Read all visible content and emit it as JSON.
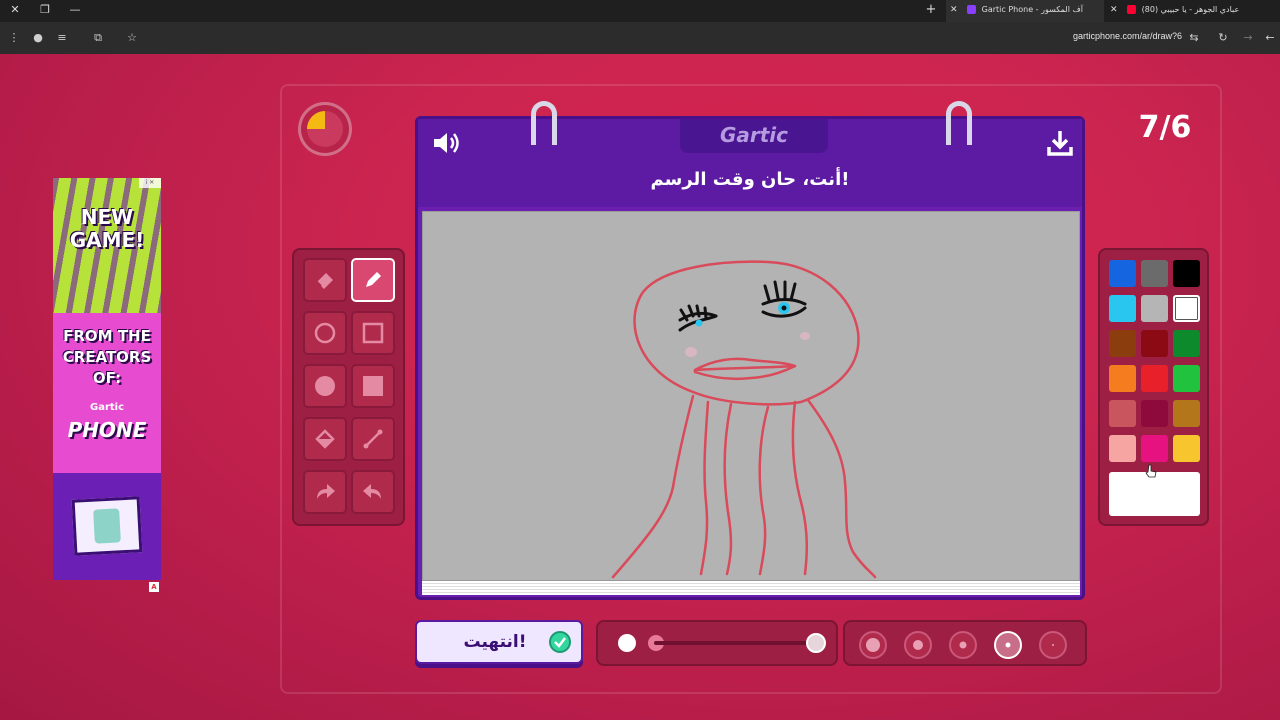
{
  "browser": {
    "tabs": [
      {
        "label": "(80) عبادي الجوهر - يا حبيبي",
        "favicon_color": "#ff0033"
      },
      {
        "label": "Gartic Phone - آف المكسور",
        "favicon_color": "#8a3ffc",
        "active": true
      }
    ],
    "url": "garticphone.com/ar/draw?6",
    "new_tab_label": "+"
  },
  "ad": {
    "headline": "NEW GAME!",
    "subline": "FROM THE CREATORS OF:",
    "brand_small": "Gartic",
    "brand": "PHONE",
    "badge": "i ✕",
    "flag": "A"
  },
  "game": {
    "round_counter": "7/6",
    "timer_fraction_elapsed": 0.25,
    "logo": "Gartic",
    "prompt": "أنت، حان وقت الرسم!",
    "done_button_label": "انتهيت!",
    "selected_tool": "pen",
    "tools": [
      "eraser",
      "pen",
      "ellipse-outline",
      "rectangle-outline",
      "ellipse-filled",
      "rectangle-filled",
      "fill-bucket",
      "line",
      "redo",
      "undo"
    ],
    "colors": [
      "#1565e0",
      "#6b6b6b",
      "#000000",
      "#29c6f0",
      "#b5b5b5",
      "#ffffff",
      "#8b3d0e",
      "#8b0a14",
      "#0d8a2c",
      "#f57c1f",
      "#e8202a",
      "#21c23d",
      "#c9555f",
      "#8e0a3c",
      "#b3761b",
      "#f6a5a3",
      "#e5127f",
      "#f7c62f"
    ],
    "selected_color": "#ffffff",
    "opacity_level": 1.0,
    "brush_size_selected_index": 3,
    "accent": "#6a1fb0",
    "background": "#c72a4a"
  }
}
